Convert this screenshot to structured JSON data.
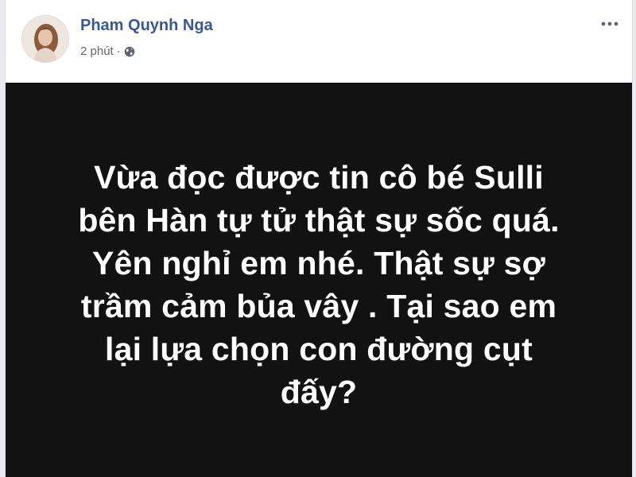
{
  "post": {
    "author_name": "Pham Quynh Nga",
    "timestamp": "2 phút",
    "separator": "·",
    "privacy_icon": "globe-icon",
    "more_icon": "more-options-icon",
    "avatar_icon": "profile-photo",
    "status_lines": [
      "Vừa đọc được tin cô bé Sulli",
      "bên Hàn tự tử thật sự sốc quá.",
      "Yên nghỉ em nhé. Thật sự sợ",
      "trầm cảm bủa vây . Tại sao em",
      "lại lựa chọn con đường cụt",
      "đấy?"
    ],
    "colors": {
      "author_link": "#385898",
      "status_background": "#121212",
      "status_text": "#ffffff",
      "meta_text": "#606770"
    }
  }
}
